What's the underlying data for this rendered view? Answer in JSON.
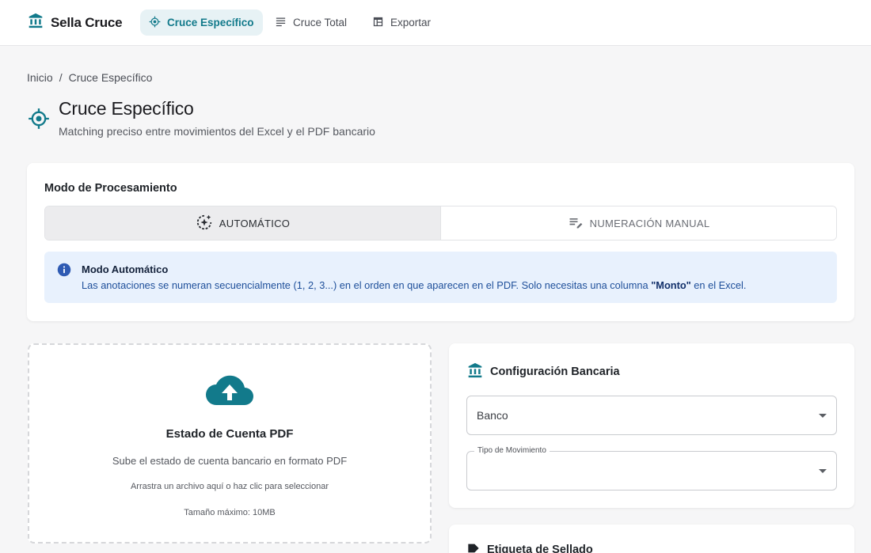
{
  "app": {
    "brand_name": "Sella Cruce"
  },
  "nav": {
    "items": [
      {
        "label": "Cruce Específico",
        "icon": "target-icon",
        "active": true
      },
      {
        "label": "Cruce Total",
        "icon": "list-icon",
        "active": false
      },
      {
        "label": "Exportar",
        "icon": "table-icon",
        "active": false
      }
    ]
  },
  "breadcrumb": {
    "home": "Inicio",
    "separator": "/",
    "current": "Cruce Específico"
  },
  "page": {
    "title": "Cruce Específico",
    "subtitle": "Matching preciso entre movimientos del Excel y el PDF bancario"
  },
  "mode": {
    "heading": "Modo de Procesamiento",
    "options": [
      {
        "label": "AUTOMÁTICO",
        "icon": "auto-mode-icon",
        "selected": true
      },
      {
        "label": "NUMERACIÓN MANUAL",
        "icon": "edit-list-icon",
        "selected": false
      }
    ],
    "info": {
      "title": "Modo Automático",
      "text_before": "Las anotaciones se numeran secuencialmente (1, 2, 3...) en el orden en que aparecen en el PDF. Solo necesitas una columna ",
      "text_bold": "\"Monto\"",
      "text_after": " en el Excel."
    }
  },
  "upload": {
    "title": "Estado de Cuenta PDF",
    "subtitle": "Sube el estado de cuenta bancario en formato PDF",
    "hint": "Arrastra un archivo aquí o haz clic para seleccionar",
    "max_size": "Tamaño máximo: 10MB"
  },
  "bank_config": {
    "heading": "Configuración Bancaria",
    "bank_select": {
      "value": "Banco"
    },
    "movement_type_select": {
      "label": "Tipo de Movimiento",
      "value": ""
    }
  },
  "seal": {
    "heading": "Etiqueta de Sellado"
  },
  "colors": {
    "primary": "#127a8b",
    "active_nav_bg": "#e7f2f5",
    "info_bg": "#e8f1fd",
    "info_icon": "#2f5bb3",
    "info_text": "#1e4f9a"
  }
}
